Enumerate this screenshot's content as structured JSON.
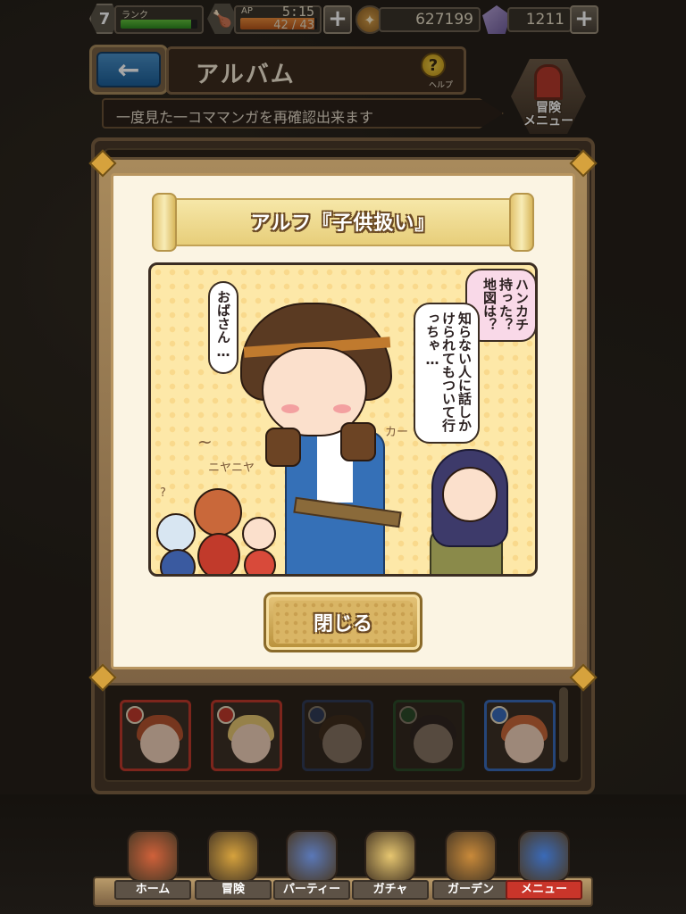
{
  "status": {
    "rank": {
      "level": "7",
      "label": "ランク",
      "progress": 0.92
    },
    "ap": {
      "label": "AP",
      "timer": "5:15",
      "value": "42 / 43",
      "progress": 0.97
    },
    "coins": "627199",
    "gems": "1211",
    "plus_symbol": "+"
  },
  "header": {
    "back_arrow": "←",
    "title": "アルバム",
    "help_symbol": "?",
    "help_label": "ヘルプ",
    "subtitle": "一度見た一コママンガを再確認出来ます",
    "adventure_menu_label": "冒険\nメニュー"
  },
  "modal": {
    "comic_title": "アルフ『子供扱い』",
    "bubbles": {
      "left": "おばさん…",
      "right_top": "ハンカチ持った？地図は？",
      "right_middle": "知らない人に話しかけられてもついて行っちゃ…"
    },
    "sfx": {
      "kaa": "カー",
      "niyaniya": "ニヤニヤ",
      "question": "?",
      "swirl": "~"
    },
    "close_label": "閉じる"
  },
  "thumbnails": [
    {
      "element": "fire",
      "hair": "#b5542e",
      "frame": "#c13a2b"
    },
    {
      "element": "fire",
      "hair": "#e6c670",
      "frame": "#c13a2b"
    },
    {
      "element": "wind",
      "hair": "#5a3a22",
      "frame": "#3a5aa0"
    },
    {
      "element": "earth",
      "hair": "#3a2a2a",
      "frame": "#2f7a3a"
    },
    {
      "element": "wind",
      "hair": "#c9683a",
      "frame": "#3a6ab8"
    }
  ],
  "nav": {
    "items": [
      {
        "label": "ホーム",
        "icon": "house-icon"
      },
      {
        "label": "冒険",
        "icon": "map-scroll-icon"
      },
      {
        "label": "パーティー",
        "icon": "chess-pieces-icon"
      },
      {
        "label": "ガチャ",
        "icon": "crystal-icon"
      },
      {
        "label": "ガーデン",
        "icon": "burger-icon"
      },
      {
        "label": "メニュー",
        "icon": "book-icon"
      }
    ],
    "active_index": 5
  },
  "colors": {
    "accent_red": "#c9352a",
    "gold": "#d6a23d",
    "panel_cream": "#fbf4e3"
  }
}
